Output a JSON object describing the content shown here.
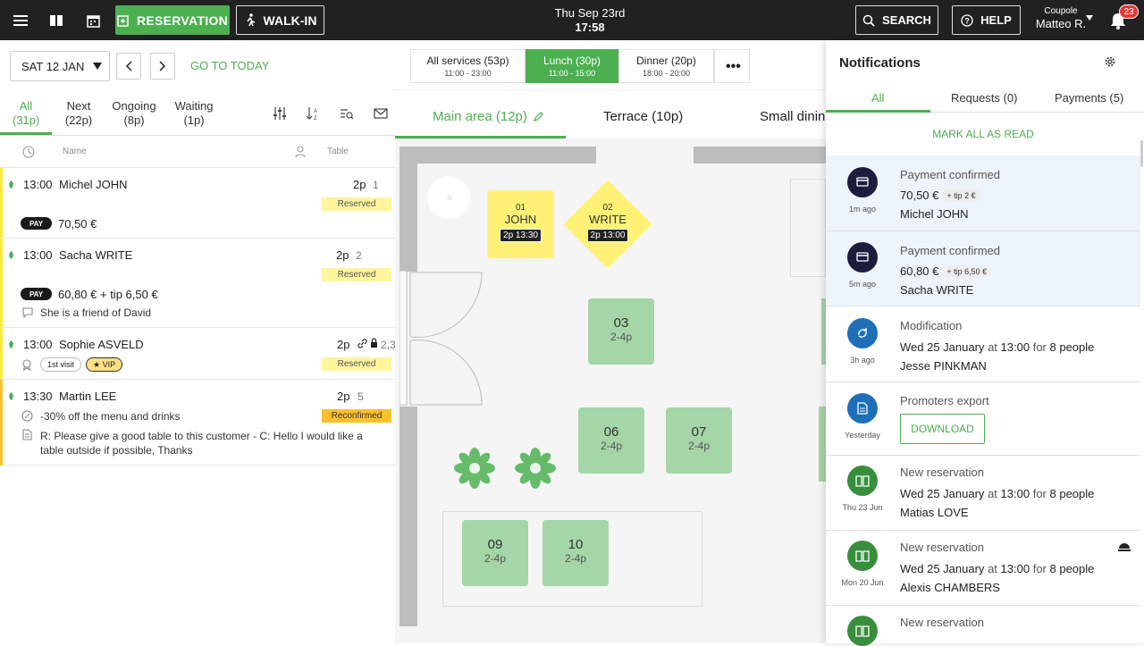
{
  "topbar": {
    "reservation_label": "RESERVATION",
    "walkin_label": "WALK-IN",
    "date": "Thu Sep 23rd",
    "time": "17:58",
    "search_label": "SEARCH",
    "help_label": "HELP",
    "restaurant": "Coupole",
    "user": "Matteo R.",
    "notif_count": "23"
  },
  "left": {
    "date": "SAT 12 JAN",
    "goto_today": "GO TO TODAY",
    "filters": [
      {
        "label": "All",
        "count": "(31p)"
      },
      {
        "label": "Next",
        "count": "(22p)"
      },
      {
        "label": "Ongoing",
        "count": "(8p)"
      },
      {
        "label": "Waiting",
        "count": "(1p)"
      }
    ],
    "col_name": "Name",
    "col_table": "Table",
    "bookings": [
      {
        "time": "13:00",
        "name": "Michel JOHN",
        "pax": "2p",
        "table": "1",
        "status": "Reserved",
        "pay_badge": "PAY",
        "amount": "70,50 €"
      },
      {
        "time": "13:00",
        "name": "Sacha WRITE",
        "pax": "2p",
        "table": "2",
        "status": "Reserved",
        "pay_badge": "PAY",
        "amount": "60,80 € + tip 6,50 €",
        "note": "She is a friend of David"
      },
      {
        "time": "13:00",
        "name": "Sophie ASVELD",
        "pax": "2p",
        "table": "2,3",
        "status": "Reserved",
        "chip1": "1st visit",
        "chip2": "★ VIP"
      },
      {
        "time": "13:30",
        "name": "Martin LEE",
        "pax": "2p",
        "table": "5",
        "status": "Reconfirmed",
        "offer": "-30% off the menu and drinks",
        "note": "R: Please give a good table to this customer - C: Hello I would like a table outside if possible, Thanks"
      }
    ]
  },
  "services": [
    {
      "name": "All services (53p)",
      "hours": "11:00 - 23:00"
    },
    {
      "name": "Lunch (30p)",
      "hours": "11:00 - 15:00"
    },
    {
      "name": "Dinner (20p)",
      "hours": "18:00 - 20:00"
    }
  ],
  "more_label": "•••",
  "areas": [
    {
      "label": "Main area (12p)"
    },
    {
      "label": "Terrace (10p)"
    },
    {
      "label": "Small dinin"
    }
  ],
  "tables": {
    "t01": {
      "no": "01",
      "name": "JOHN",
      "tag": "2p 13:30"
    },
    "t02": {
      "no": "02",
      "name": "WRITE",
      "tag": "2p 13:00"
    },
    "t03": {
      "no": "03",
      "cap": "2-4p"
    },
    "t06": {
      "no": "06",
      "cap": "2-4p"
    },
    "t07": {
      "no": "07",
      "cap": "2-4p"
    },
    "t09": {
      "no": "09",
      "cap": "2-4p"
    },
    "t10": {
      "no": "10",
      "cap": "2-4p"
    }
  },
  "notifications": {
    "title": "Notifications",
    "tabs": [
      "All",
      "Requests (0)",
      "Payments (5)"
    ],
    "mark_all": "MARK ALL AS READ",
    "items": [
      {
        "ago": "1m ago",
        "title": "Payment confirmed",
        "amount": "70,50 €",
        "tip": "+ tip 2 €",
        "person": "Michel JOHN"
      },
      {
        "ago": "5m ago",
        "title": "Payment confirmed",
        "amount": "60,80 €",
        "tip": "+ tip 6,50 €",
        "person": "Sacha WRITE"
      },
      {
        "ago": "3h ago",
        "title": "Modification",
        "date": "Wed 25 January",
        "at": "at",
        "time": "13:00",
        "for": "for",
        "people": "8 people",
        "person": "Jesse PINKMAN"
      },
      {
        "ago": "Yesterday",
        "title": "Promoters export",
        "button": "DOWNLOAD"
      },
      {
        "ago": "Thu 23 Jun",
        "title": "New reservation",
        "date": "Wed 25 January",
        "at": "at",
        "time": "13:00",
        "for": "for",
        "people": "8 people",
        "person": "Matias LOVE"
      },
      {
        "ago": "Mon 20 Jun",
        "title": "New reservation",
        "date": "Wed 25 January",
        "at": "at",
        "time": "13:00",
        "for": "for",
        "people": "8 people",
        "person": "Alexis CHAMBERS"
      },
      {
        "title": "New reservation"
      }
    ]
  },
  "colors": {
    "accent": "#4caf50",
    "dark": "#212121",
    "reserved": "#fff59d",
    "reconfirmed": "#fbc02d"
  }
}
